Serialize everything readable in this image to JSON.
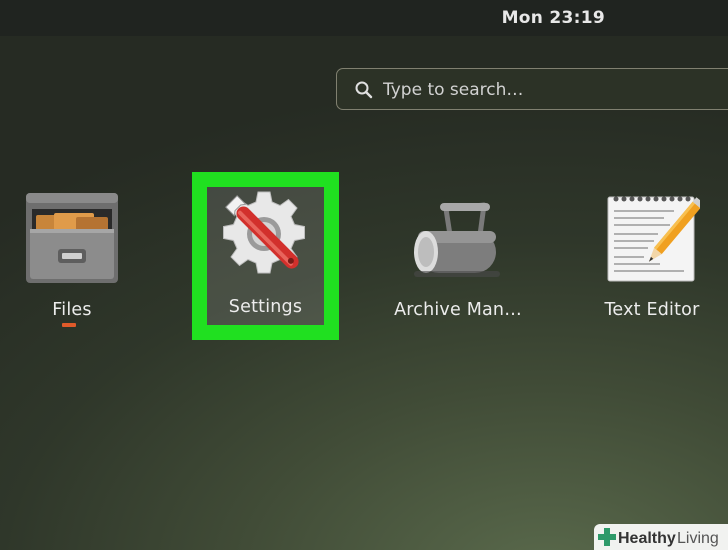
{
  "topbar": {
    "clock": "Mon 23:19"
  },
  "search": {
    "placeholder": "Type to search…",
    "icon": "search-icon"
  },
  "apps": [
    {
      "label": "Files",
      "icon": "file-cabinet-icon",
      "running": true
    },
    {
      "label": "Settings",
      "icon": "settings-gear-wrench-icon",
      "selected": true,
      "highlight_color": "#20e020"
    },
    {
      "label": "Archive Man…",
      "icon": "archive-roller-icon"
    },
    {
      "label": "Text Editor",
      "icon": "notepad-pencil-icon"
    }
  ],
  "watermark": {
    "text": "Healthy Living"
  }
}
